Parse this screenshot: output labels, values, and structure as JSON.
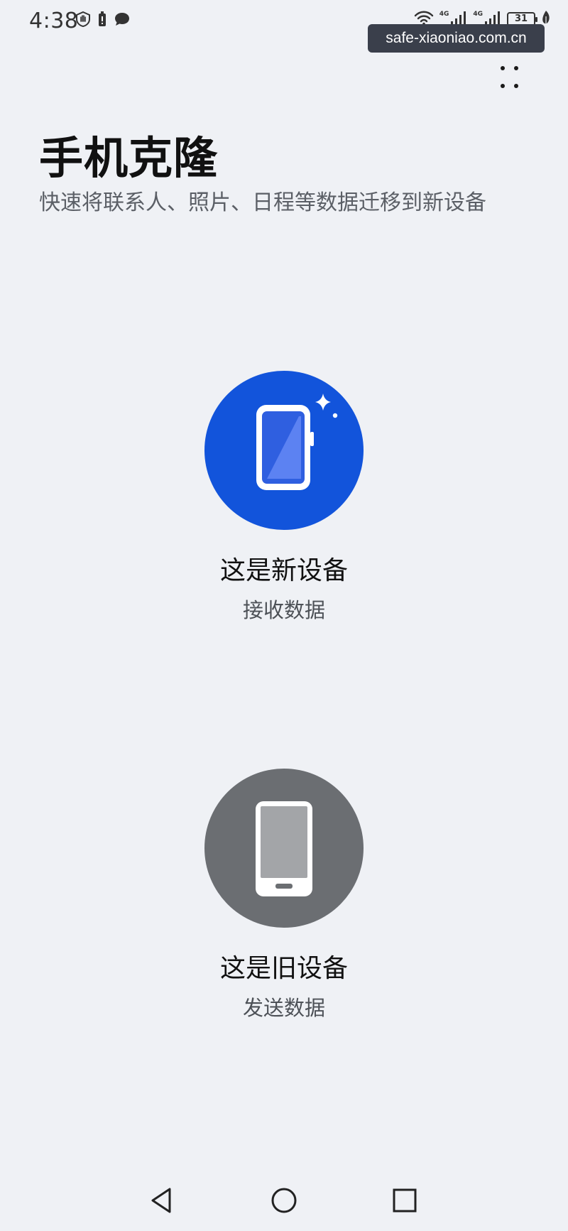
{
  "status_bar": {
    "time": "4:38",
    "network_label_1": "4G",
    "network_label_2": "4G",
    "battery_level": "31"
  },
  "watermark": {
    "text": "safe-xiaoniao.com.cn"
  },
  "header": {
    "title": "手机克隆",
    "subtitle": "快速将联系人、照片、日程等数据迁移到新设备"
  },
  "options": {
    "new_device": {
      "title": "这是新设备",
      "subtitle": "接收数据",
      "icon": "new-phone-icon",
      "color": "#1254db"
    },
    "old_device": {
      "title": "这是旧设备",
      "subtitle": "发送数据",
      "icon": "old-phone-icon",
      "color": "#6b6e72"
    }
  },
  "nav_bar": {
    "back": "back-icon",
    "home": "home-icon",
    "recents": "recents-icon"
  },
  "colors": {
    "background": "#eff1f5",
    "accent": "#1254db"
  }
}
